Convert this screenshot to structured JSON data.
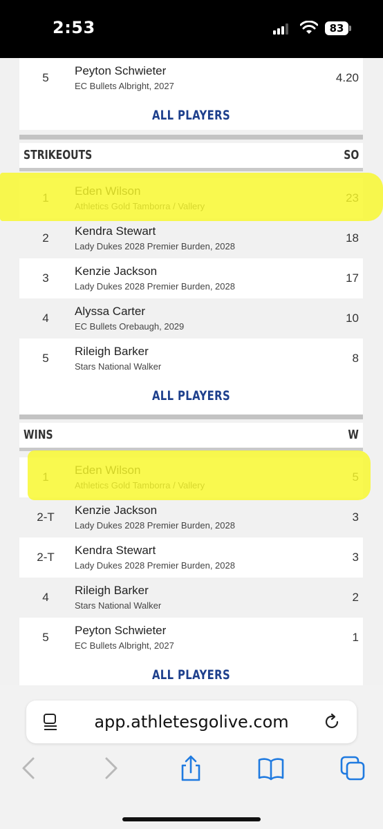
{
  "status_bar": {
    "time": "2:53",
    "battery": "83"
  },
  "top_partial": {
    "row": {
      "rank": "5",
      "name": "Peyton Schwieter",
      "team": "EC Bullets Albright, 2027",
      "value": "4.20"
    },
    "all_players_label": "ALL PLAYERS"
  },
  "strikeouts": {
    "title": "STRIKEOUTS",
    "column": "SO",
    "rows": [
      {
        "rank": "1",
        "name": "Eden Wilson",
        "team": "Athletics Gold Tamborra / Vallery",
        "value": "23"
      },
      {
        "rank": "2",
        "name": "Kendra Stewart",
        "team": "Lady Dukes 2028 Premier Burden, 2028",
        "value": "18"
      },
      {
        "rank": "3",
        "name": "Kenzie Jackson",
        "team": "Lady Dukes 2028 Premier Burden, 2028",
        "value": "17"
      },
      {
        "rank": "4",
        "name": "Alyssa Carter",
        "team": "EC Bullets Orebaugh, 2029",
        "value": "10"
      },
      {
        "rank": "5",
        "name": "Rileigh Barker",
        "team": "Stars National Walker",
        "value": "8"
      }
    ],
    "all_players_label": "ALL PLAYERS"
  },
  "wins": {
    "title": "WINS",
    "column": "W",
    "rows": [
      {
        "rank": "1",
        "name": "Eden Wilson",
        "team": "Athletics Gold Tamborra / Vallery",
        "value": "5"
      },
      {
        "rank": "2-T",
        "name": "Kenzie Jackson",
        "team": "Lady Dukes 2028 Premier Burden, 2028",
        "value": "3"
      },
      {
        "rank": "2-T",
        "name": "Kendra Stewart",
        "team": "Lady Dukes 2028 Premier Burden, 2028",
        "value": "3"
      },
      {
        "rank": "4",
        "name": "Rileigh Barker",
        "team": "Stars National Walker",
        "value": "2"
      },
      {
        "rank": "5",
        "name": "Peyton Schwieter",
        "team": "EC Bullets Albright, 2027",
        "value": "1"
      }
    ],
    "all_players_label": "ALL PLAYERS"
  },
  "browser": {
    "url": "app.athletesgolive.com",
    "icons": [
      "reader-icon",
      "reload-icon",
      "back-icon",
      "forward-icon",
      "share-icon",
      "bookmarks-icon",
      "tabs-icon"
    ]
  },
  "colors": {
    "accent": "#1d3f8c",
    "highlight": "#f8f828",
    "alt_row": "#f1f1f1"
  }
}
